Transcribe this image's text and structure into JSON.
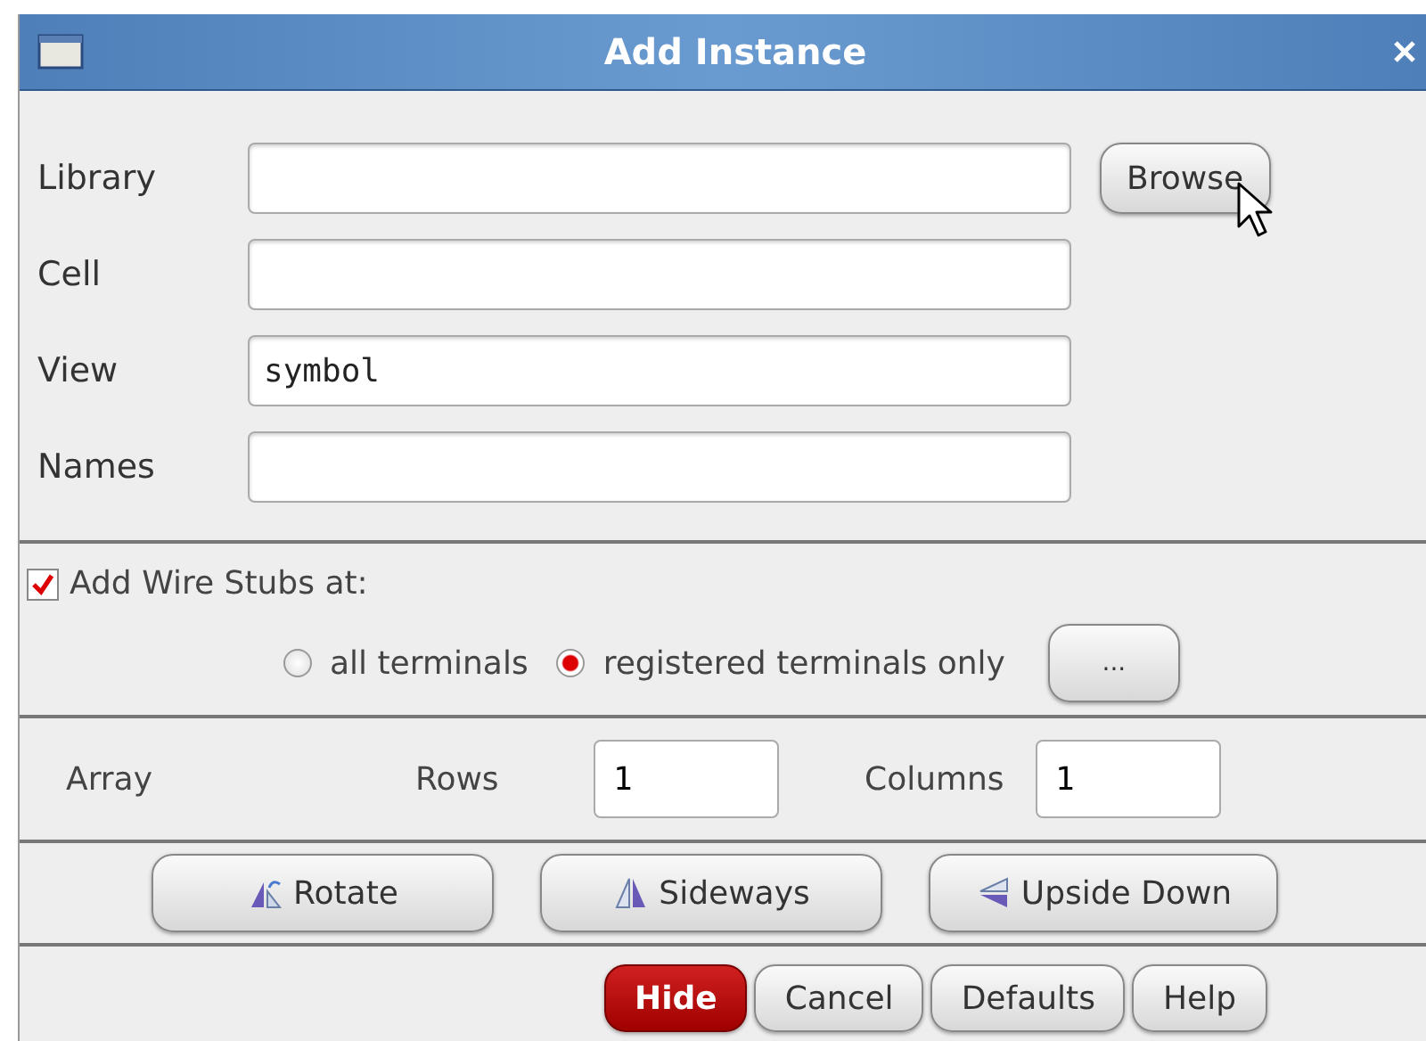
{
  "window": {
    "title": "Add Instance"
  },
  "fields": [
    {
      "label": "Library"
    },
    {
      "label": "Cell"
    },
    {
      "label": "View",
      "value": "symbol"
    },
    {
      "label": "Names"
    }
  ],
  "browse_button": "Browse",
  "wire_stubs": {
    "label": "Add Wire Stubs at:",
    "checked": true,
    "options": [
      {
        "label": "all terminals",
        "selected": false
      },
      {
        "label": "registered terminals only",
        "selected": true
      }
    ],
    "more_button": "..."
  },
  "array": {
    "label": "Array",
    "rows_label": "Rows",
    "rows": "1",
    "columns_label": "Columns",
    "columns": "1"
  },
  "transform_buttons": [
    {
      "label": "Rotate",
      "kind": "rotate"
    },
    {
      "label": "Sideways",
      "kind": "sideways"
    },
    {
      "label": "Upside Down",
      "kind": "upside"
    }
  ],
  "buttons": [
    {
      "label": "Hide",
      "kind": "default"
    },
    {
      "label": "Cancel",
      "kind": "normal"
    },
    {
      "label": "Defaults",
      "kind": "normal"
    },
    {
      "label": "Help",
      "kind": "normal"
    }
  ]
}
